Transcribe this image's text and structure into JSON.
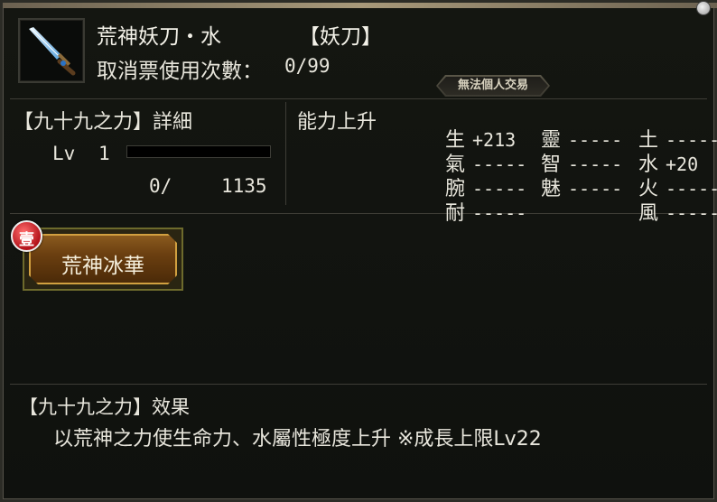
{
  "item": {
    "name": "荒神妖刀・水",
    "type_tag": "【妖刀】",
    "usage_label": "取消票使用次數：",
    "usage_value": "0/99",
    "icon": "sword-icon"
  },
  "no_trade_badge": "無法個人交易",
  "power_section": {
    "title": "【九十九之力】詳細",
    "lv_label": "Lv",
    "lv_value": "1",
    "exp_current": "0/",
    "exp_max": "1135",
    "exp_progress": 0
  },
  "abilities": {
    "title": "能力上升",
    "col1": [
      {
        "key": "生",
        "val": "+213"
      },
      {
        "key": "氣",
        "val": "-----"
      },
      {
        "key": "腕",
        "val": "-----"
      },
      {
        "key": "耐",
        "val": "-----"
      }
    ],
    "col2": [
      {
        "key": "靈",
        "val": "-----"
      },
      {
        "key": "智",
        "val": "-----"
      },
      {
        "key": "魅",
        "val": "-----"
      }
    ],
    "col3": [
      {
        "key": "土",
        "val": "-----"
      },
      {
        "key": "水",
        "val": "+20"
      },
      {
        "key": "火",
        "val": "-----"
      },
      {
        "key": "風",
        "val": "-----"
      }
    ]
  },
  "skill": {
    "badge": "壹",
    "label": "荒神冰華"
  },
  "effect": {
    "title": "【九十九之力】效果",
    "description": "以荒神之力使生命力、水屬性極度上升 ※成長上限Lv22"
  },
  "colors": {
    "accent_gold": "#d1a040",
    "badge_red": "#b3121a"
  }
}
